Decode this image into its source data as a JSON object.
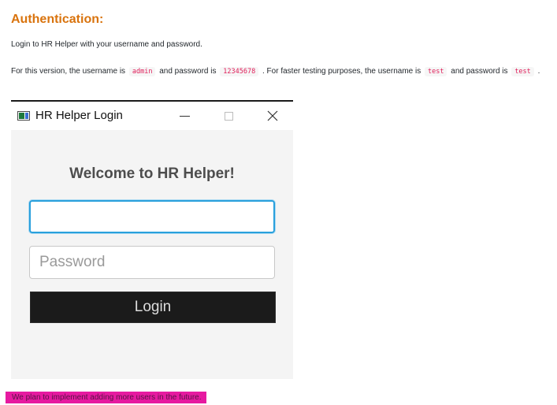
{
  "doc": {
    "heading": "Authentication:",
    "intro": "Login to HR Helper with your username and password.",
    "creds": {
      "prefix": "For this version, the username is",
      "username": "admin",
      "and1": "and password is",
      "password": "12345678",
      "middle": ". For faster testing purposes, the username is",
      "test_user": "test",
      "and2": "and password is",
      "test_pass": "test",
      "end": "."
    },
    "future_note": "We plan to implement adding more users in the future."
  },
  "window": {
    "title": "HR Helper Login",
    "welcome": "Welcome to HR Helper!",
    "username_value": "",
    "password_placeholder": "Password",
    "login_label": "Login",
    "controls": {
      "minimize": "—",
      "close": "✕"
    }
  },
  "colors": {
    "heading": "#d9730d",
    "code": "#e01e5a",
    "focus": "#29a0dc",
    "login_bg": "#1b1b1b",
    "highlight": "#e61aa0"
  }
}
